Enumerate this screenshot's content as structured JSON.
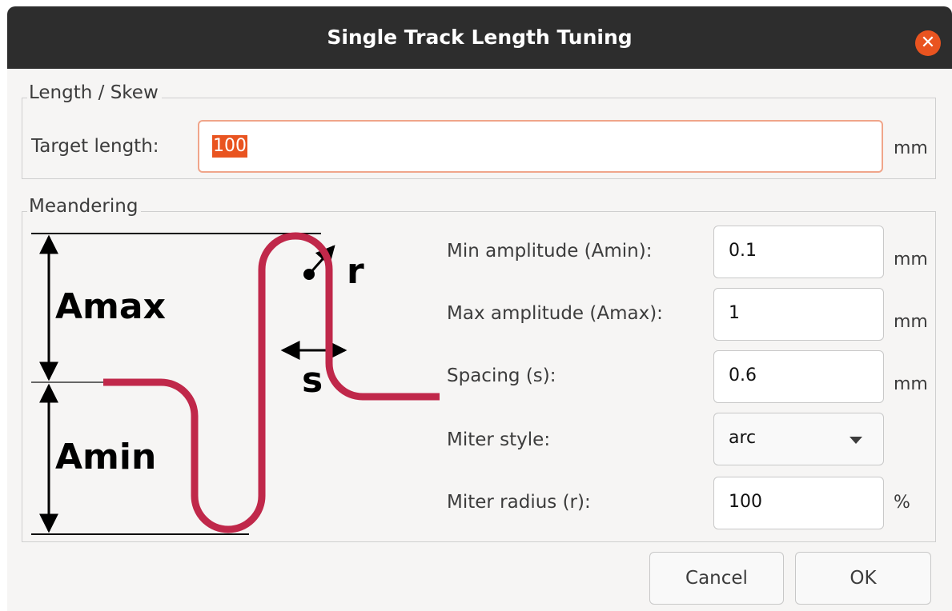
{
  "window": {
    "title": "Single Track Length Tuning"
  },
  "length_skew": {
    "group_label": "Length / Skew",
    "target_label": "Target length:",
    "target_value": "100",
    "target_unit": "mm"
  },
  "meandering": {
    "group_label": "Meandering",
    "diagram": {
      "amax": "Amax",
      "amin": "Amin",
      "r": "r",
      "s": "s"
    },
    "min_amp": {
      "label": "Min amplitude (Amin):",
      "value": "0.1",
      "unit": "mm"
    },
    "max_amp": {
      "label": "Max amplitude (Amax):",
      "value": "1",
      "unit": "mm"
    },
    "spacing": {
      "label": "Spacing (s):",
      "value": "0.6",
      "unit": "mm"
    },
    "miter_style": {
      "label": "Miter style:",
      "value": "arc"
    },
    "miter_radius": {
      "label": "Miter radius (r):",
      "value": "100",
      "unit": "%"
    }
  },
  "buttons": {
    "cancel": "Cancel",
    "ok": "OK"
  },
  "colors": {
    "titlebar": "#2d2d2d",
    "close": "#e95420",
    "selection": "#e95420",
    "track": "#c0284a"
  }
}
